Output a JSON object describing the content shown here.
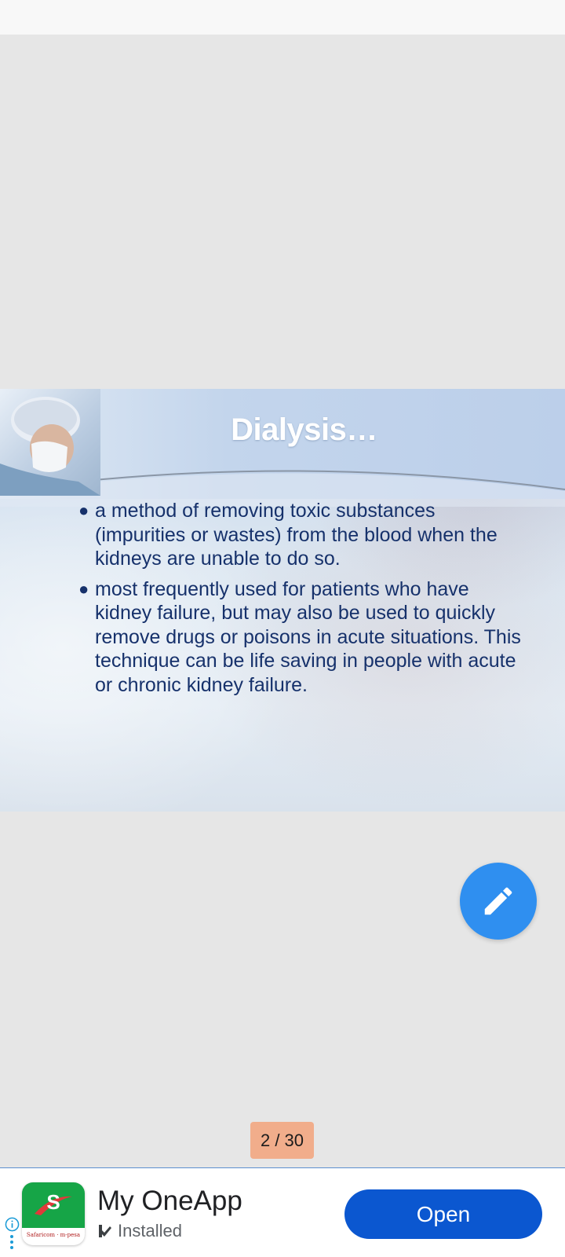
{
  "slide": {
    "title": "Dialysis…",
    "bullets": [
      "a method of removing toxic substances (impurities or wastes) from the blood when the kidneys are unable to do so.",
      "most frequently used for patients who have kidney failure, but may also be used to quickly remove drugs or poisons in acute situations. This technique can be life saving in people with acute or chronic kidney failure."
    ],
    "bullet_symbol": "●"
  },
  "page_indicator": "2 / 30",
  "edit_button": {
    "icon": "pencil-icon",
    "color": "#2f8ff0"
  },
  "ad": {
    "app_name": "My OneApp",
    "status": "Installed",
    "button_label": "Open",
    "app_icon_letter": "S",
    "app_icon_brand": "Safaricom · m-pesa",
    "button_color": "#0b57d0"
  },
  "colors": {
    "background": "#e6e6e6",
    "slide_text": "#16316b",
    "page_indicator": "#f1ad8b"
  }
}
